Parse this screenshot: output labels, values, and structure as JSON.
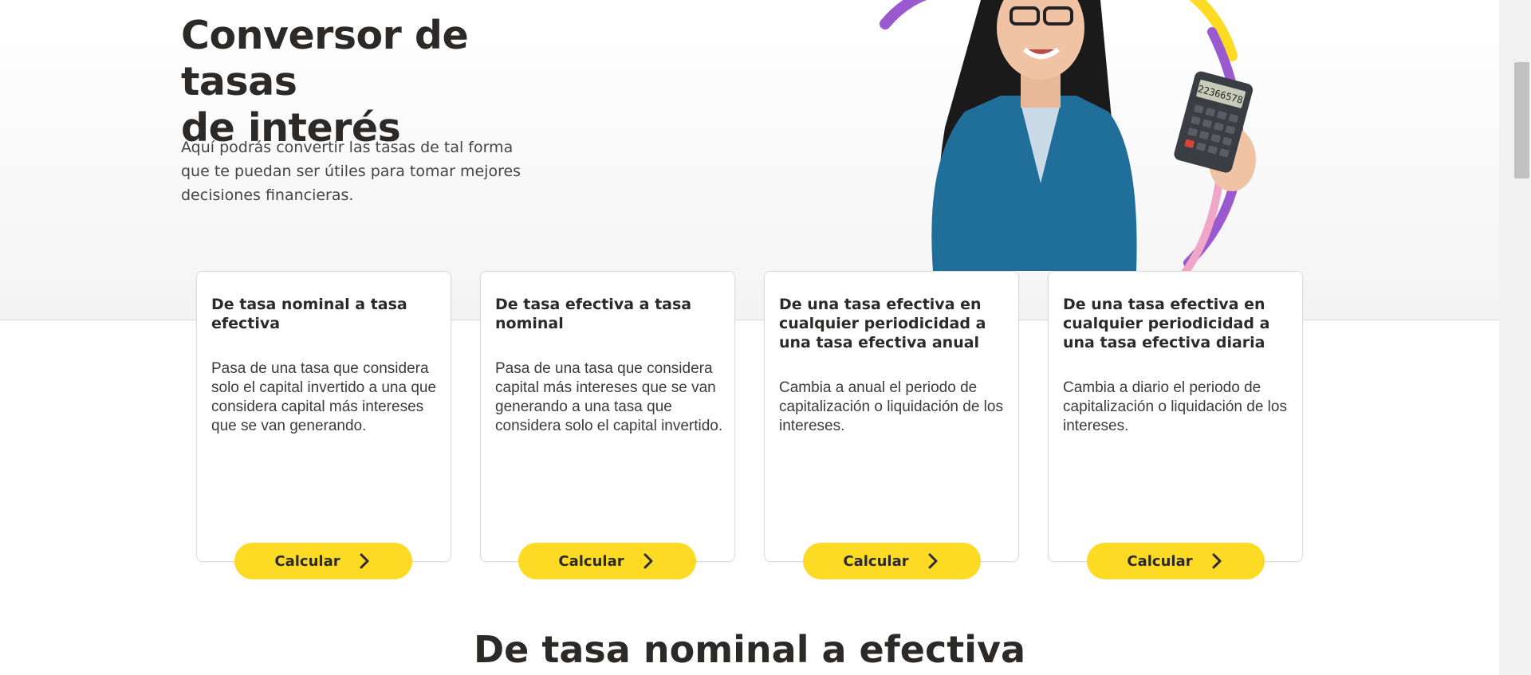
{
  "hero": {
    "title_line1": "Conversor de tasas",
    "title_line2": "de interés",
    "description": "Aquí podrás convertir las tasas de tal forma que te puedan ser útiles para tomar mejores decisiones financieras.",
    "image_icon": "woman-with-calculator-illustration",
    "calculator_display": "22366578"
  },
  "cards": [
    {
      "title": "De tasa nominal a tasa efectiva",
      "description": "Pasa de una tasa que considera solo el capital invertido a una que considera capital más intereses que se van generando.",
      "button_label": "Calcular"
    },
    {
      "title": "De tasa efectiva a tasa nominal",
      "description": "Pasa de una tasa que considera capital más intereses que se van generando a una tasa que considera solo el capital invertido.",
      "button_label": "Calcular"
    },
    {
      "title": "De una tasa efectiva en cualquier periodicidad a una tasa efectiva anual",
      "description": "Cambia a anual el periodo de capitalización o liquidación de los intereses.",
      "button_label": "Calcular"
    },
    {
      "title": "De una tasa efectiva en cualquier periodicidad a una tasa efectiva diaria",
      "description": "Cambia a diario el periodo de capitalización o liquidación de los intereses.",
      "button_label": "Calcular"
    }
  ],
  "section": {
    "title": "De tasa nominal a efectiva"
  },
  "icons": {
    "button_icon": "chevron-right-icon"
  },
  "colors": {
    "accent_yellow": "#fdda24",
    "accent_purple": "#9b59d0",
    "accent_pink": "#f0a6c8",
    "text_dark": "#2c2a29"
  }
}
